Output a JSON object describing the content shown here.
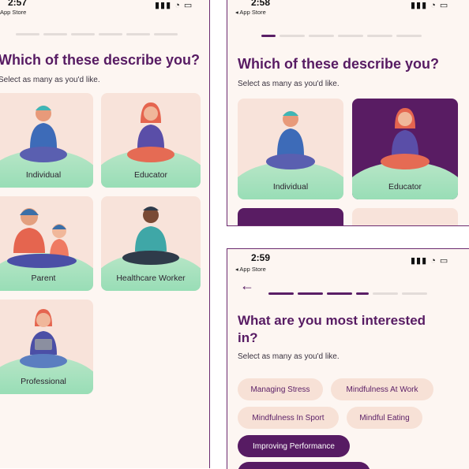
{
  "screen1": {
    "time": "2:57",
    "store": "App Store",
    "title": "Which of these describe you?",
    "subtitle": "Select as many as you'd like.",
    "cards": [
      "Individual",
      "Educator",
      "Parent",
      "Healthcare Worker",
      "Professional"
    ]
  },
  "screen2": {
    "time": "2:58",
    "store": "◂ App Store",
    "title": "Which of these describe you?",
    "subtitle": "Select as many as you'd like.",
    "cards": [
      "Individual",
      "Educator"
    ]
  },
  "screen3": {
    "time": "2:59",
    "store": "◂ App Store",
    "back": "←",
    "title_line1": "What are you most interested",
    "title_line2": "in?",
    "subtitle": "Select as many as you'd like.",
    "chips": [
      "Managing Stress",
      "Mindfulness At Work",
      "Mindfulness In Sport",
      "Mindful Eating",
      "Improving Performance"
    ]
  },
  "status_icons": "▮▮▮ ◔ ▭",
  "colors": {
    "brand": "#571b63",
    "card": "#f8e3da",
    "hill": "#7ed6a8",
    "chip": "#f7e1d6"
  }
}
